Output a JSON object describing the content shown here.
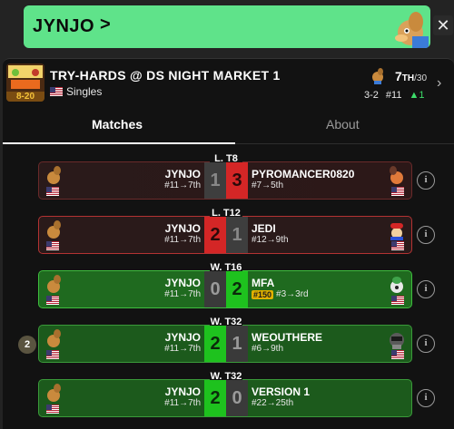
{
  "banner": {
    "name": "JYNJO",
    "chevron": ">"
  },
  "close_label": "✕",
  "event": {
    "title": "TRY-HARDS @ DS NIGHT MARKET 1",
    "thumb_score": "8-20",
    "format": "Singles",
    "placement": "7",
    "placement_suffix": "TH",
    "placement_total": "/30",
    "record": "3-2",
    "seed": "#11",
    "seed_change": "▲1"
  },
  "tabs": {
    "matches": "Matches",
    "about": "About"
  },
  "matches": [
    {
      "round": "L. T8",
      "left_name": "JYNJO",
      "left_seed": "#11→7th",
      "left_score": "1",
      "right_score": "3",
      "right_name": "PYROMANCER0820",
      "right_seed": "#7→5th"
    },
    {
      "round": "L. T12",
      "left_name": "JYNJO",
      "left_seed": "#11→7th",
      "left_score": "2",
      "right_score": "1",
      "right_name": "JEDI",
      "right_seed": "#12→9th"
    },
    {
      "round": "W. T16",
      "left_name": "JYNJO",
      "left_seed": "#11→7th",
      "left_score": "0",
      "right_score": "2",
      "right_name": "MFA",
      "right_badge": "#150",
      "right_seed": "#3→3rd"
    },
    {
      "round": "W. T32",
      "left_name": "JYNJO",
      "left_seed": "#11→7th",
      "left_score": "2",
      "right_score": "1",
      "right_name": "WEOUTHERE",
      "right_seed": "#6→9th"
    },
    {
      "round": "W. T32",
      "left_name": "JYNJO",
      "left_seed": "#11→7th",
      "left_score": "2",
      "right_score": "0",
      "right_name": "VERSION 1",
      "right_seed": "#22→25th"
    }
  ],
  "game_count": "2",
  "info_label": "i"
}
